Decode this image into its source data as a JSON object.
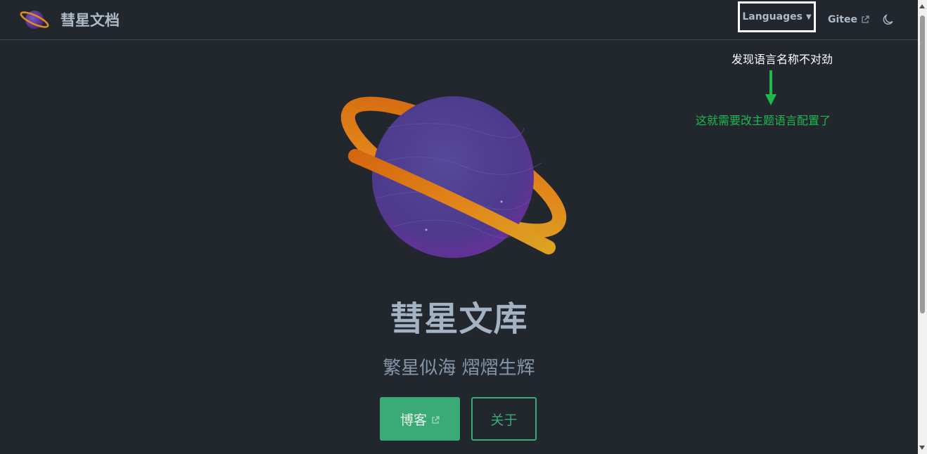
{
  "navbar": {
    "site_title": "彗星文档",
    "languages_label": "Languages",
    "gitee_label": "Gitee",
    "icons": {
      "logo": "planet-logo-icon",
      "dropdown": "caret-down-icon",
      "external": "external-link-icon",
      "theme": "moon-icon"
    }
  },
  "annotations": {
    "note": "发现语言名称不对劲",
    "note_color": "#ffffff",
    "hint": "这就需要改主题语言配置了",
    "hint_color": "#1fb84f",
    "arrow_icon": "arrow-down-icon"
  },
  "hero": {
    "title": "彗星文库",
    "tagline": "繁星似海 熠熠生辉",
    "primary_button": "博客",
    "secondary_button": "关于",
    "accent_color": "#3aaa77"
  }
}
